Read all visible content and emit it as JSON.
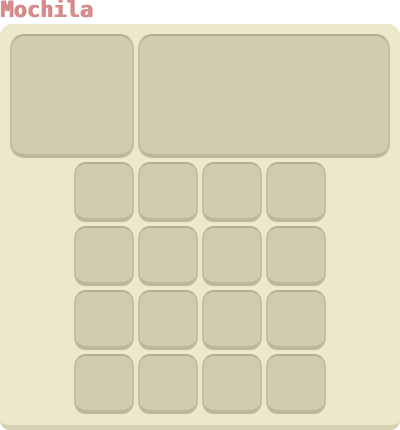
{
  "window": {
    "title": "Mochila"
  },
  "inventory": {
    "large_slots": [
      {
        "slot": "left-panel",
        "content": ""
      },
      {
        "slot": "right-panel",
        "content": ""
      }
    ],
    "grid": {
      "rows": 4,
      "cols": 4
    }
  },
  "colors": {
    "title": "#d98c8c",
    "panel_bg": "#ece8cc",
    "slot_bg": "#cfccaf",
    "slot_border": "#c2bea0"
  }
}
